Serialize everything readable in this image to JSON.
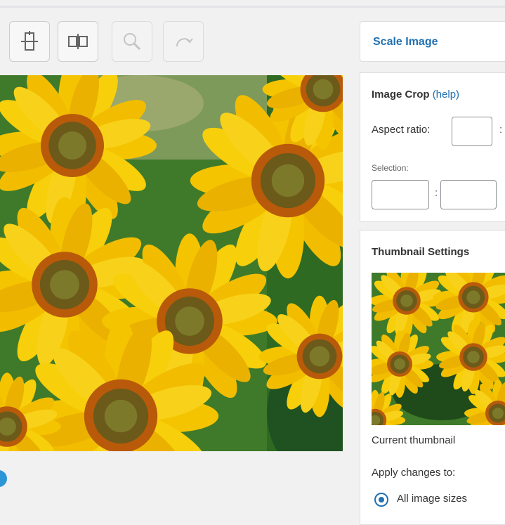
{
  "toolbar": {
    "buttons": [
      {
        "name": "crop-icon",
        "enabled": true
      },
      {
        "name": "flip-icon",
        "enabled": true
      },
      {
        "name": "zoom-icon",
        "enabled": false
      },
      {
        "name": "redo-icon",
        "enabled": false
      }
    ]
  },
  "scale": {
    "label": "Scale Image"
  },
  "crop": {
    "title": "Image Crop",
    "help_label": "(help)",
    "aspect_label": "Aspect ratio:",
    "aspect_sep": ":",
    "selection_label": "Selection:",
    "selection_sep": ":"
  },
  "thumbnail": {
    "title": "Thumbnail Settings",
    "caption": "Current thumbnail",
    "apply_label": "Apply changes to:",
    "option_all": "All image sizes"
  },
  "colors": {
    "accent": "#2271b1",
    "info": "#2c95d6",
    "sunflower": "#f5c400"
  }
}
